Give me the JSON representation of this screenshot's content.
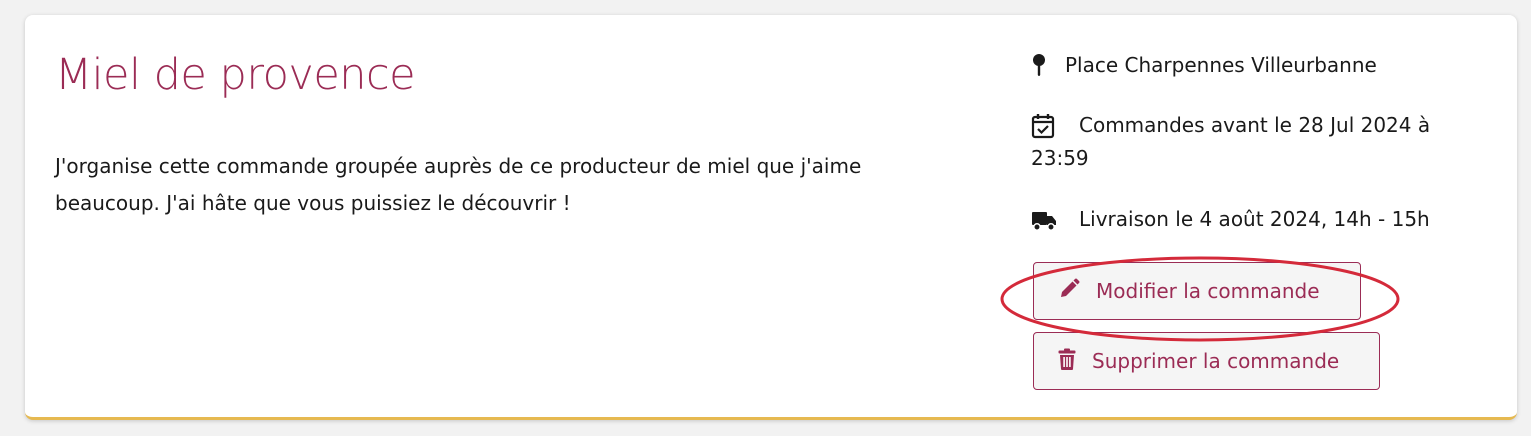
{
  "card": {
    "title": "Miel de provence",
    "description": "J'organise cette commande groupée auprès de ce producteur de miel que j'aime beaucoup. J'ai hâte que vous puissiez le découvrir !",
    "location": "Place Charpennes Villeurbanne",
    "deadline": "Commandes avant le 28 Jul 2024 à 23:59",
    "delivery": "Livraison le 4 août 2024, 14h - 15h"
  },
  "actions": {
    "edit_label": "Modifier la commande",
    "delete_label": "Supprimer la commande"
  },
  "colors": {
    "accent": "#9b2c55",
    "border_bottom": "#e6b950",
    "annotation": "#d42a3a"
  },
  "icons": {
    "location": "map-pin-icon",
    "deadline": "calendar-check-icon",
    "delivery": "truck-icon",
    "edit": "pencil-icon",
    "delete": "trash-icon"
  }
}
